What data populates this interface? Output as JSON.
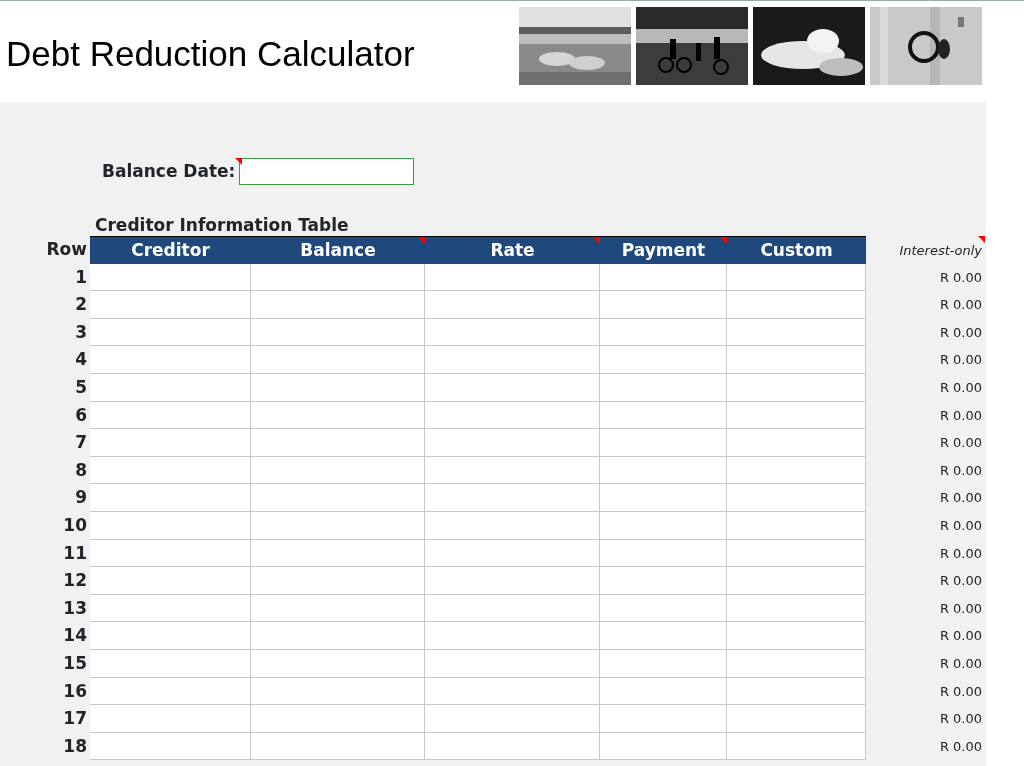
{
  "title": "Debt Reduction Calculator",
  "photos": [
    {
      "kind": "beach"
    },
    {
      "kind": "cyclists"
    },
    {
      "kind": "hands"
    },
    {
      "kind": "knocker"
    }
  ],
  "balance_date": {
    "label": "Balance Date:",
    "has_comment": true
  },
  "table": {
    "title": "Creditor Information Table",
    "row_header": "Row",
    "columns": [
      {
        "label": "Creditor",
        "has_comment": false
      },
      {
        "label": "Balance",
        "has_comment": true
      },
      {
        "label": "Rate",
        "has_comment": true
      },
      {
        "label": "Payment",
        "has_comment": true
      },
      {
        "label": "Custom",
        "has_comment": false
      }
    ],
    "extra_column": {
      "label": "Interest-only",
      "has_comment": true
    },
    "rows": [
      {
        "number": "1",
        "interest_only": "R 0.00"
      },
      {
        "number": "2",
        "interest_only": "R 0.00"
      },
      {
        "number": "3",
        "interest_only": "R 0.00"
      },
      {
        "number": "4",
        "interest_only": "R 0.00"
      },
      {
        "number": "5",
        "interest_only": "R 0.00"
      },
      {
        "number": "6",
        "interest_only": "R 0.00"
      },
      {
        "number": "7",
        "interest_only": "R 0.00"
      },
      {
        "number": "8",
        "interest_only": "R 0.00"
      },
      {
        "number": "9",
        "interest_only": "R 0.00"
      },
      {
        "number": "10",
        "interest_only": "R 0.00"
      },
      {
        "number": "11",
        "interest_only": "R 0.00"
      },
      {
        "number": "12",
        "interest_only": "R 0.00"
      },
      {
        "number": "13",
        "interest_only": "R 0.00"
      },
      {
        "number": "14",
        "interest_only": "R 0.00"
      },
      {
        "number": "15",
        "interest_only": "R 0.00"
      },
      {
        "number": "16",
        "interest_only": "R 0.00"
      },
      {
        "number": "17",
        "interest_only": "R 0.00"
      },
      {
        "number": "18",
        "interest_only": "R 0.00"
      }
    ]
  }
}
